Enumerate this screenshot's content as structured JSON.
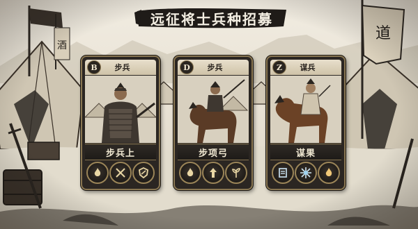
{
  "title": "远征将士兵种招募",
  "cards": [
    {
      "badge": "B",
      "type_label": "步兵",
      "name": "步兵上",
      "skills": [
        "flame-burst-icon",
        "crossed-spears-icon",
        "shield-slash-icon"
      ]
    },
    {
      "badge": "D",
      "type_label": "步兵",
      "name": "步项弓",
      "skills": [
        "flame-burst-icon",
        "rising-arrow-icon",
        "sprout-icon"
      ]
    },
    {
      "badge": "Z",
      "type_label": "谋兵",
      "name": "谋果",
      "skills": [
        "banner-shield-icon",
        "frost-burst-icon",
        "flame-burst-icon"
      ]
    }
  ],
  "colors": {
    "card_frame": "#8a7752",
    "card_bg": "#2b2622",
    "ink": "#2a2520",
    "parchment": "#e9e3d6",
    "title_text": "#f4efe3"
  }
}
